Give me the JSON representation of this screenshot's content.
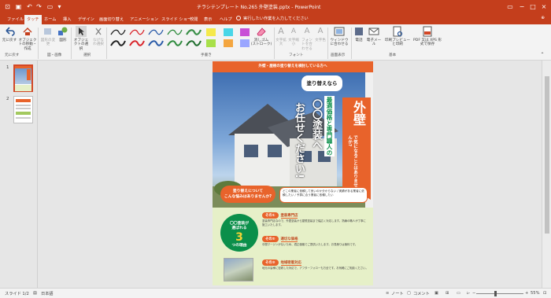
{
  "window": {
    "title": "チラシテンプレート No.265 外壁塗装.pptx - PowerPoint",
    "controls": [
      "−",
      "□",
      "×"
    ],
    "title_right_icon": "restore-ribbon-icon"
  },
  "tabs": [
    {
      "label": "ファイル"
    },
    {
      "label": "タッチ"
    },
    {
      "label": "ホーム"
    },
    {
      "label": "挿入"
    },
    {
      "label": "デザイン"
    },
    {
      "label": "画面切り替え"
    },
    {
      "label": "アニメーション"
    },
    {
      "label": "スライド ショー"
    },
    {
      "label": "校閲"
    },
    {
      "label": "表示"
    },
    {
      "label": "ヘルプ"
    }
  ],
  "tellme": "実行したい作業を入力してください",
  "ribbon": {
    "undo_label": "元に戻す",
    "convert_label": "オブジェクトの移動・",
    "convert_label2": "作成",
    "undo_group": "元に戻す",
    "shapes_label1": "図形の変更",
    "shapes_label2": "図形",
    "shapes_group": "図・画像",
    "select_label": "オブジェクトの選択",
    "lasso_label": "なげなわ選択",
    "select_group": "選択",
    "pen_group": "手書き",
    "eraser_label1": "消しゴム",
    "eraser_label2": "(ストローク)",
    "font_bigger": "文字拡大",
    "font_smaller": "文字縮小",
    "font_size": "フォントを合わせる",
    "font_color": "文字色",
    "font_group": "フォント",
    "window_label1": "ウィンドウ",
    "window_label2": "に合わせる",
    "window_group": "画面表示",
    "tel_label": "電話",
    "mail_label": "電子メール",
    "print_label": "印刷プレビュー と印刷",
    "pdf_label": "PDF 又は XPS 形式で保存",
    "basic_group": "基本"
  },
  "thumbnails": [
    {
      "num": "1"
    },
    {
      "num": "2"
    }
  ],
  "slide": {
    "banner": "外壁・屋根の塗り替えを検討している方へ",
    "bubble": "塗り替えなら",
    "line1": "最適価格と専門職人の",
    "line2": "〇〇塗装へ",
    "line3": "お任せください!",
    "vertical_big": "外壁",
    "vertical_small": "で気になることはありませんか?",
    "worry_title1": "塗り替えについて",
    "worry_title2": "こんな悩みはありませんか?",
    "worry_note": "どこの業者に依頼して良いのか分からない / 実績がある業者に依頼したい / 予算に合う業者に依頼したい",
    "reasons_circle1": "〇〇塗装が",
    "reasons_circle2": "選ばれる",
    "reasons_circle3": "3",
    "reasons_circle4": "つの理由",
    "reasons": [
      {
        "no": "その①",
        "title": "塗装専門店",
        "text": "塗装専門店なので、外壁塗装から屋根塗装まで幅広く対応します。熟練の職人が丁寧に施工いたします。"
      },
      {
        "no": "その②",
        "title": "適切な価格",
        "text": "中間マージンがないため、適正価格でご提供いたします。お見積りは無料です。"
      },
      {
        "no": "その③",
        "title": "地域密着対応",
        "text": "地元の皆様に密着した対応で、アフターフォローも万全です。お気軽にご相談ください。"
      }
    ]
  },
  "status": {
    "slide": "スライド 1/2",
    "lang": "日本語",
    "notes": "ノート",
    "comments": "コメント",
    "zoom": "55%"
  }
}
